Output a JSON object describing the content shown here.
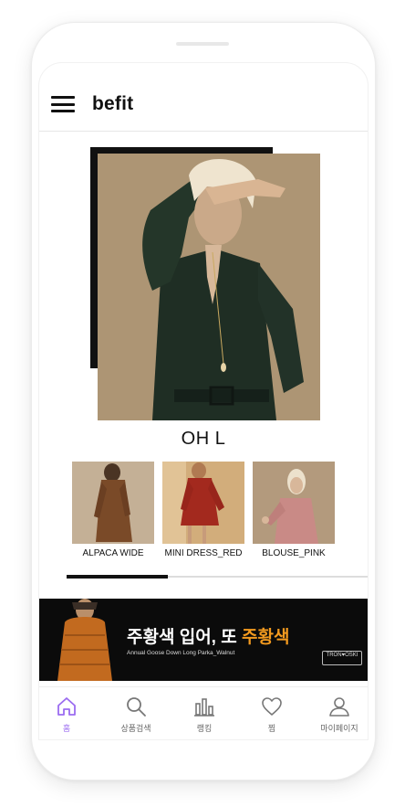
{
  "header": {
    "title": "befit"
  },
  "hero": {
    "brand": "OH L"
  },
  "products": [
    {
      "name": "ALPACA WIDE"
    },
    {
      "name": "MINI DRESS_RED"
    },
    {
      "name": "BLOUSE_PINK"
    }
  ],
  "carousel": {
    "progress": 0.333
  },
  "banner": {
    "title_prefix": "주황색 입어, 또 ",
    "title_accent": "주황색",
    "subtitle": "Annual Goose Down Long Parka_Walnut",
    "logo_text": "TRON♥OSKI"
  },
  "nav": {
    "items": [
      {
        "label": "홈",
        "icon": "home-icon",
        "active": true
      },
      {
        "label": "상품검색",
        "icon": "search-icon",
        "active": false
      },
      {
        "label": "랭킹",
        "icon": "ranking-icon",
        "active": false
      },
      {
        "label": "찜",
        "icon": "heart-icon",
        "active": false
      },
      {
        "label": "마이페이지",
        "icon": "user-icon",
        "active": false
      }
    ]
  },
  "colors": {
    "accent": "#9b6cf0",
    "banner_accent": "#f39a1f",
    "banner_bg": "#0b0b0b"
  }
}
